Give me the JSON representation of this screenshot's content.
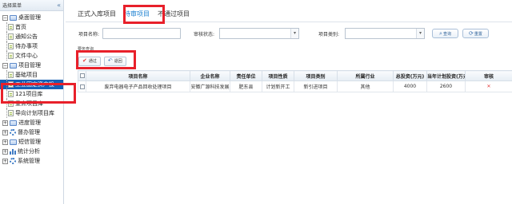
{
  "sidebar": {
    "title": "选择菜单",
    "collapse_icon": "«",
    "items": [
      {
        "label": "桌面管理",
        "level": 1,
        "icon": "folder-icon",
        "expander": "−"
      },
      {
        "label": "首页",
        "level": 2,
        "icon": "page-icon"
      },
      {
        "label": "通知公告",
        "level": 2,
        "icon": "page-icon"
      },
      {
        "label": "待办事项",
        "level": 2,
        "icon": "page-icon"
      },
      {
        "label": "文件中心",
        "level": 2,
        "icon": "page-icon"
      },
      {
        "label": "项目管理",
        "level": 1,
        "icon": "folder-icon",
        "expander": "−"
      },
      {
        "label": "基础项目",
        "level": 2,
        "icon": "page-icon"
      },
      {
        "label": "工业固定资产投",
        "level": 2,
        "icon": "page-icon",
        "selected": true
      },
      {
        "label": "121项目库",
        "level": 2,
        "icon": "page-icon"
      },
      {
        "label": "重点项目库",
        "level": 2,
        "icon": "page-icon"
      },
      {
        "label": "导向计划项目库",
        "level": 2,
        "icon": "page-icon"
      },
      {
        "label": "进度管理",
        "level": 1,
        "icon": "folder-icon",
        "expander": "+"
      },
      {
        "label": "督办管理",
        "level": 1,
        "icon": "gear-icon",
        "expander": "+"
      },
      {
        "label": "短信管理",
        "level": 1,
        "icon": "folder-icon",
        "expander": "+"
      },
      {
        "label": "统计分析",
        "level": 1,
        "icon": "chart-icon",
        "expander": "+"
      },
      {
        "label": "系统管理",
        "level": 1,
        "icon": "gear-icon",
        "expander": "+"
      }
    ]
  },
  "tabs": [
    {
      "label": "正式入库项目",
      "active": false
    },
    {
      "label": "待审项目",
      "active": true
    },
    {
      "label": "不通过项目",
      "active": false
    }
  ],
  "search": {
    "name_label": "项目名称:",
    "name_value": "",
    "status_label": "审核状态:",
    "status_value": "",
    "type_label": "项目类别:",
    "type_value": "",
    "query_button": "查询",
    "reset_button": "重置"
  },
  "panel": {
    "title": "要务查询",
    "approve_button": "通过",
    "reject_button": "退回"
  },
  "table": {
    "columns": [
      "项目名称",
      "企业名称",
      "责任单位",
      "项目性质",
      "项目类别",
      "所属行业",
      "总投资(万元)",
      "当年计划投资(万元)",
      "审核"
    ],
    "rows": [
      {
        "name": "废弃电器电子产品回收处理项目",
        "company": "安徽广源科技发展",
        "unit": "肥东县",
        "nature": "计划新开工",
        "category": "新引进项目",
        "industry": "其他",
        "total": "4000",
        "plan": "2600",
        "audit": "✕"
      }
    ]
  },
  "colors": {
    "highlight": "#e8202a",
    "selected_bg": "#1660b5",
    "active_tab": "#1a7fd0"
  }
}
